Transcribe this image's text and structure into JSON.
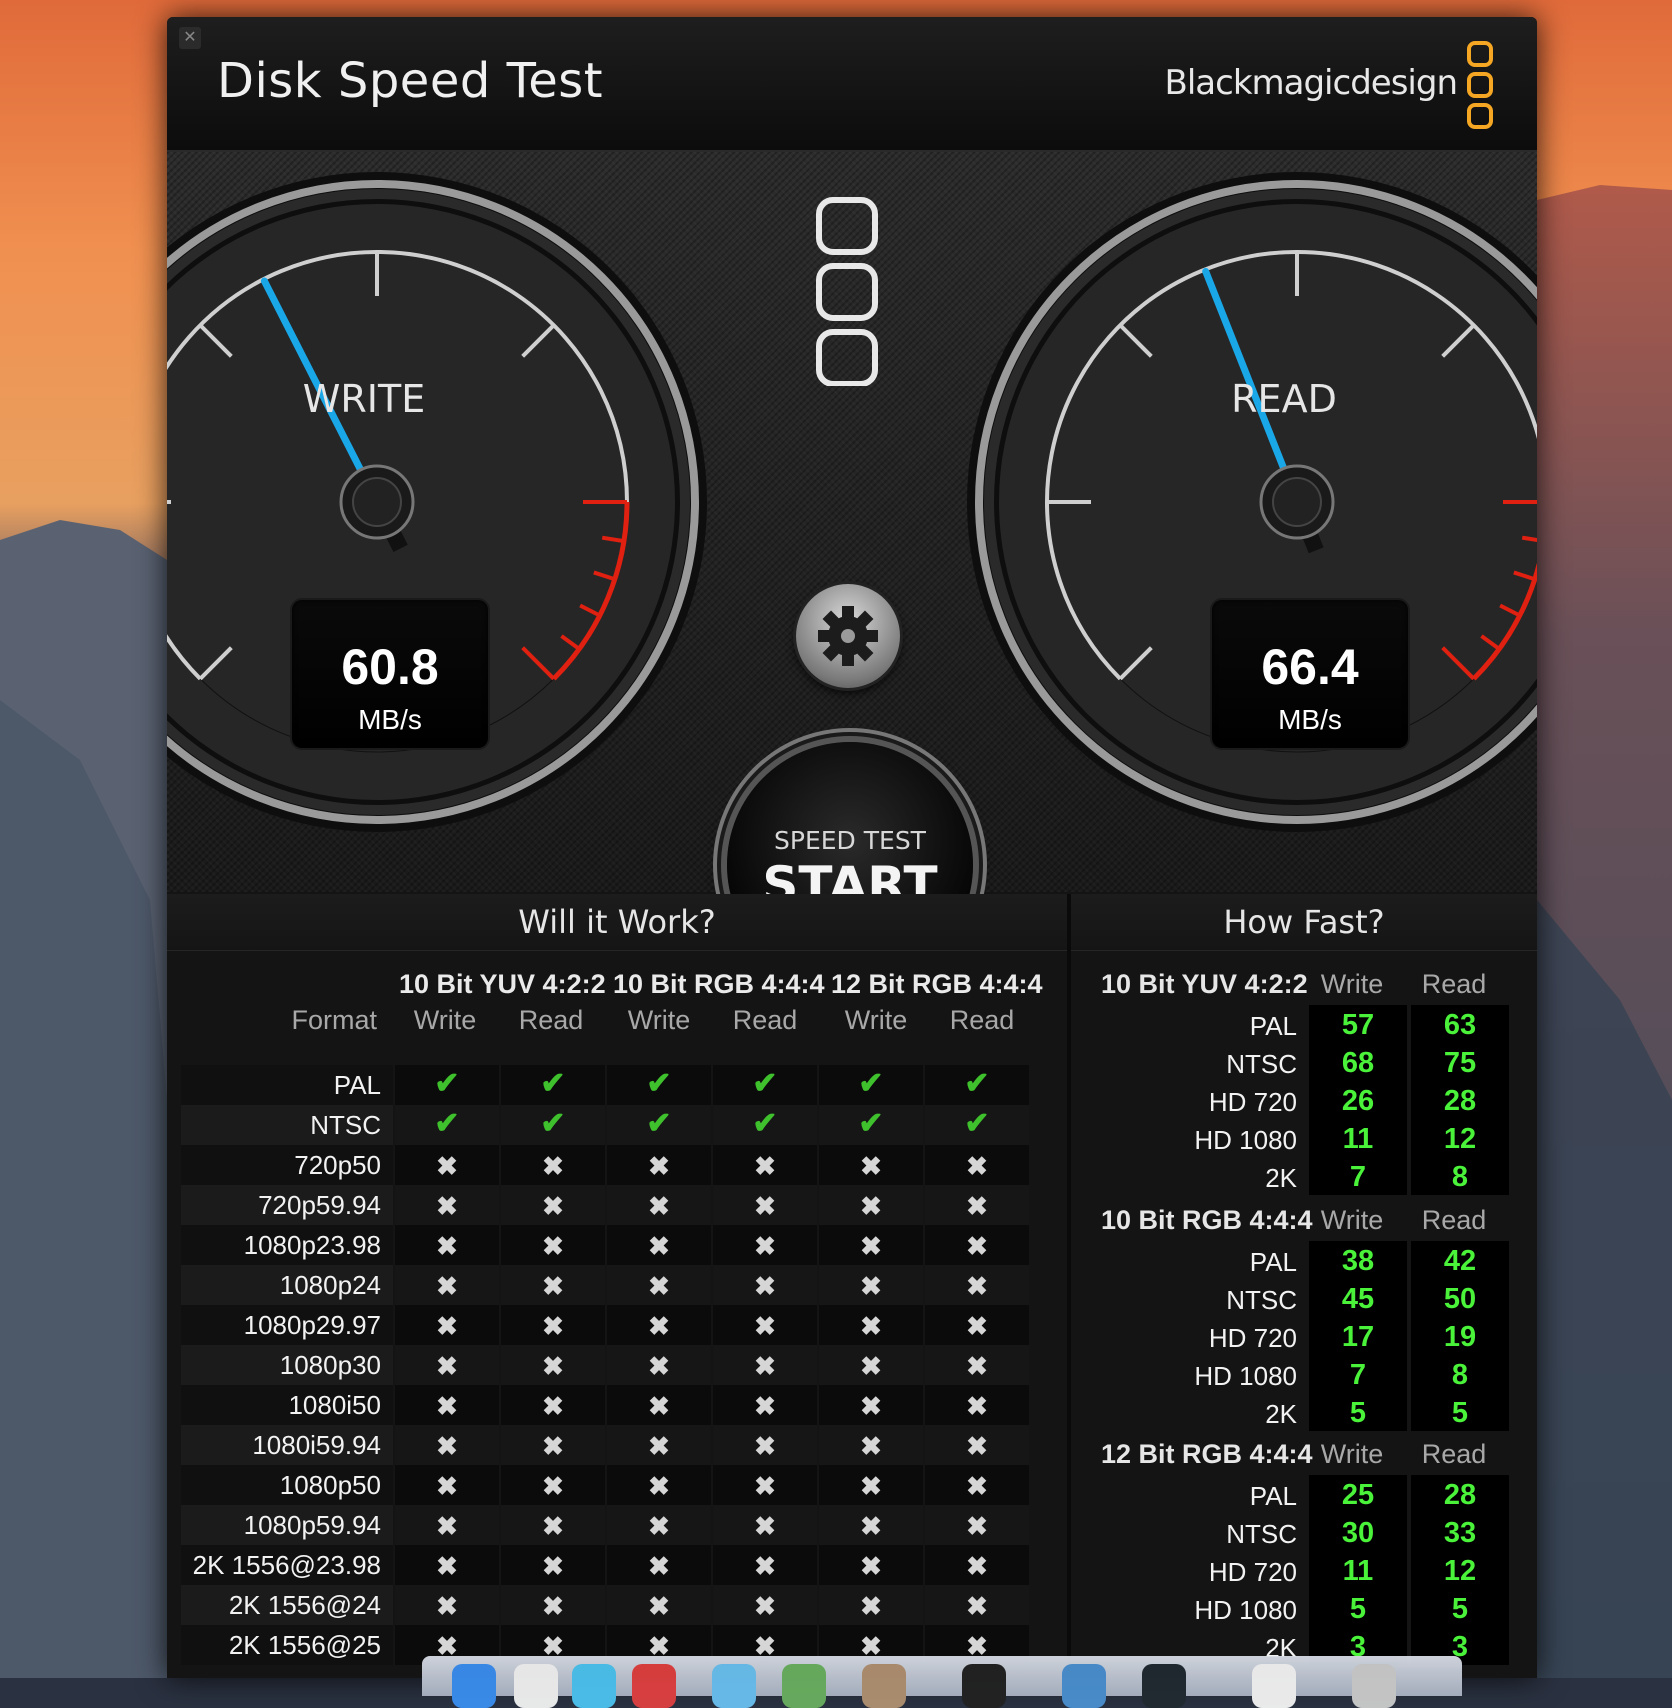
{
  "window": {
    "title": "Disk Speed Test",
    "brand": "Blackmagicdesign",
    "close_icon": "close-icon"
  },
  "gauges": {
    "write": {
      "label": "WRITE",
      "value": "60.8",
      "unit": "MB/s",
      "needle_fraction": 0.4
    },
    "read": {
      "label": "READ",
      "value": "66.4",
      "unit": "MB/s",
      "needle_fraction": 0.42
    }
  },
  "start_button": {
    "sub": "SPEED TEST",
    "main": "START"
  },
  "settings_icon": "gear-icon",
  "will_it_work": {
    "title": "Will it Work?",
    "format_header": "Format",
    "groups": [
      "10 Bit YUV 4:2:2",
      "10 Bit RGB 4:4:4",
      "12 Bit RGB 4:4:4"
    ],
    "subheaders": [
      "Write",
      "Read",
      "Write",
      "Read",
      "Write",
      "Read"
    ],
    "rows": [
      {
        "format": "PAL",
        "marks": [
          true,
          true,
          true,
          true,
          true,
          true
        ]
      },
      {
        "format": "NTSC",
        "marks": [
          true,
          true,
          true,
          true,
          true,
          true
        ]
      },
      {
        "format": "720p50",
        "marks": [
          false,
          false,
          false,
          false,
          false,
          false
        ]
      },
      {
        "format": "720p59.94",
        "marks": [
          false,
          false,
          false,
          false,
          false,
          false
        ]
      },
      {
        "format": "1080p23.98",
        "marks": [
          false,
          false,
          false,
          false,
          false,
          false
        ]
      },
      {
        "format": "1080p24",
        "marks": [
          false,
          false,
          false,
          false,
          false,
          false
        ]
      },
      {
        "format": "1080p29.97",
        "marks": [
          false,
          false,
          false,
          false,
          false,
          false
        ]
      },
      {
        "format": "1080p30",
        "marks": [
          false,
          false,
          false,
          false,
          false,
          false
        ]
      },
      {
        "format": "1080i50",
        "marks": [
          false,
          false,
          false,
          false,
          false,
          false
        ]
      },
      {
        "format": "1080i59.94",
        "marks": [
          false,
          false,
          false,
          false,
          false,
          false
        ]
      },
      {
        "format": "1080p50",
        "marks": [
          false,
          false,
          false,
          false,
          false,
          false
        ]
      },
      {
        "format": "1080p59.94",
        "marks": [
          false,
          false,
          false,
          false,
          false,
          false
        ]
      },
      {
        "format": "2K 1556@23.98",
        "marks": [
          false,
          false,
          false,
          false,
          false,
          false
        ]
      },
      {
        "format": "2K 1556@24",
        "marks": [
          false,
          false,
          false,
          false,
          false,
          false
        ]
      },
      {
        "format": "2K 1556@25",
        "marks": [
          false,
          false,
          false,
          false,
          false,
          false
        ]
      }
    ]
  },
  "how_fast": {
    "title": "How Fast?",
    "write_header": "Write",
    "read_header": "Read",
    "sections": [
      {
        "name": "10 Bit YUV 4:2:2",
        "rows": [
          {
            "format": "PAL",
            "write": "57",
            "read": "63"
          },
          {
            "format": "NTSC",
            "write": "68",
            "read": "75"
          },
          {
            "format": "HD 720",
            "write": "26",
            "read": "28"
          },
          {
            "format": "HD 1080",
            "write": "11",
            "read": "12"
          },
          {
            "format": "2K",
            "write": "7",
            "read": "8"
          }
        ]
      },
      {
        "name": "10 Bit RGB 4:4:4",
        "rows": [
          {
            "format": "PAL",
            "write": "38",
            "read": "42"
          },
          {
            "format": "NTSC",
            "write": "45",
            "read": "50"
          },
          {
            "format": "HD 720",
            "write": "17",
            "read": "19"
          },
          {
            "format": "HD 1080",
            "write": "7",
            "read": "8"
          },
          {
            "format": "2K",
            "write": "5",
            "read": "5"
          }
        ]
      },
      {
        "name": "12 Bit RGB 4:4:4",
        "rows": [
          {
            "format": "PAL",
            "write": "25",
            "read": "28"
          },
          {
            "format": "NTSC",
            "write": "30",
            "read": "33"
          },
          {
            "format": "HD 720",
            "write": "11",
            "read": "12"
          },
          {
            "format": "HD 1080",
            "write": "5",
            "read": "5"
          },
          {
            "format": "2K",
            "write": "3",
            "read": "3"
          }
        ]
      }
    ]
  },
  "colors": {
    "needle": "#1aa7e8",
    "redline": "#e02010",
    "check": "#3fc02d",
    "value_green": "#4af23a",
    "brand_orange": "#f5a623"
  }
}
